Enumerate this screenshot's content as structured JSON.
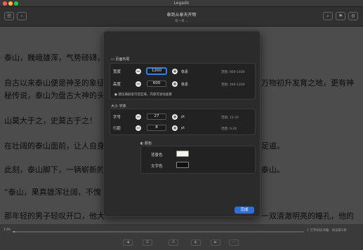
{
  "window": {
    "title": "Legado"
  },
  "toolbar": {
    "chapter_title": "泰到从泰天开物",
    "chapter_sub": "第一章 ⌄",
    "icons": [
      "sidebar-icon",
      "back-icon",
      "forward-icon",
      "search-icon",
      "bookmark-icon",
      "settings-icon"
    ]
  },
  "reader": {
    "paragraphs": [
      "泰山，巍峨雄浑，气势磅礴，",
      "自古以来泰山便是神圣的象征",
      "秘传说，泰山为盘古大神的头",
      "山莫大于之，史莫古于之！",
      "在壮阔的泰山面前，让人自身",
      "此刻，泰山脚下，一辆崭新的",
      "“泰山，果真雄浑壮阔，不愧",
      "那年轻的男子轻叹开口，他大"
    ],
    "right_fragments": [
      "万物初升发育之地，更有神",
      "足道。",
      "泰山。",
      "一双清澈明亮的瞳孔，他的"
    ]
  },
  "modal": {
    "page_layout": {
      "title": "页面布局",
      "width_label": "宽度",
      "width_value": "1200",
      "width_unit": "像素",
      "width_range": "范围: 800-1400",
      "height_label": "高度",
      "height_value": "600",
      "height_unit": "像素",
      "height_range": "范围: 400-1200",
      "hint": "● 建议满屏宽可见区域，内容可滚动查看"
    },
    "font": {
      "title": "大小 字体",
      "size_label": "字号",
      "size_value": "27",
      "size_unit": "pt",
      "size_range": "范围: 12-32",
      "spacing_label": "行距",
      "spacing_value": "8",
      "spacing_unit": "pt",
      "spacing_range": "范围: 0-20"
    },
    "colors": {
      "title": "颜色",
      "bg_label": "背景色",
      "bg_color": "#f2f5ea",
      "text_label": "文字色",
      "text_color": "#111111"
    },
    "done_label": "完成"
  },
  "bottombar": {
    "progress": 0.01,
    "left_label": "1/96",
    "right_label": "1 万字阅读书籍 · 阅读第1章"
  }
}
